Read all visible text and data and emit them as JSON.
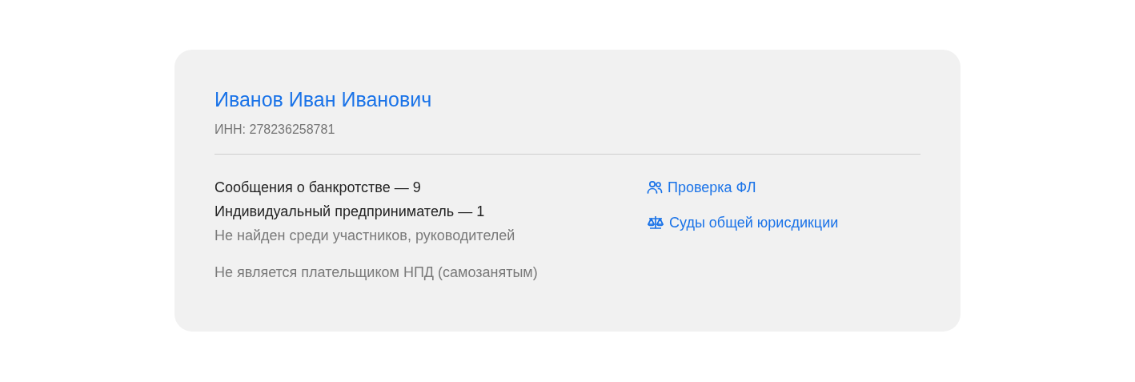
{
  "person": {
    "name": "Иванов Иван Иванович",
    "inn": "ИНН: 278236258781"
  },
  "records": [
    {
      "kind": "count",
      "text": "Сообщения о банкротстве — 9"
    },
    {
      "kind": "count",
      "text": "Индивидуальный предприниматель — 1"
    },
    {
      "kind": "note",
      "text": "Не найден среди участников, руководителей"
    }
  ],
  "tax_status": "Не является плательщиком НПД (самозанятым)",
  "links": [
    {
      "kind": "people",
      "label": "Проверка ФЛ"
    },
    {
      "kind": "scales",
      "label": "Суды общей юрисдикции"
    }
  ]
}
